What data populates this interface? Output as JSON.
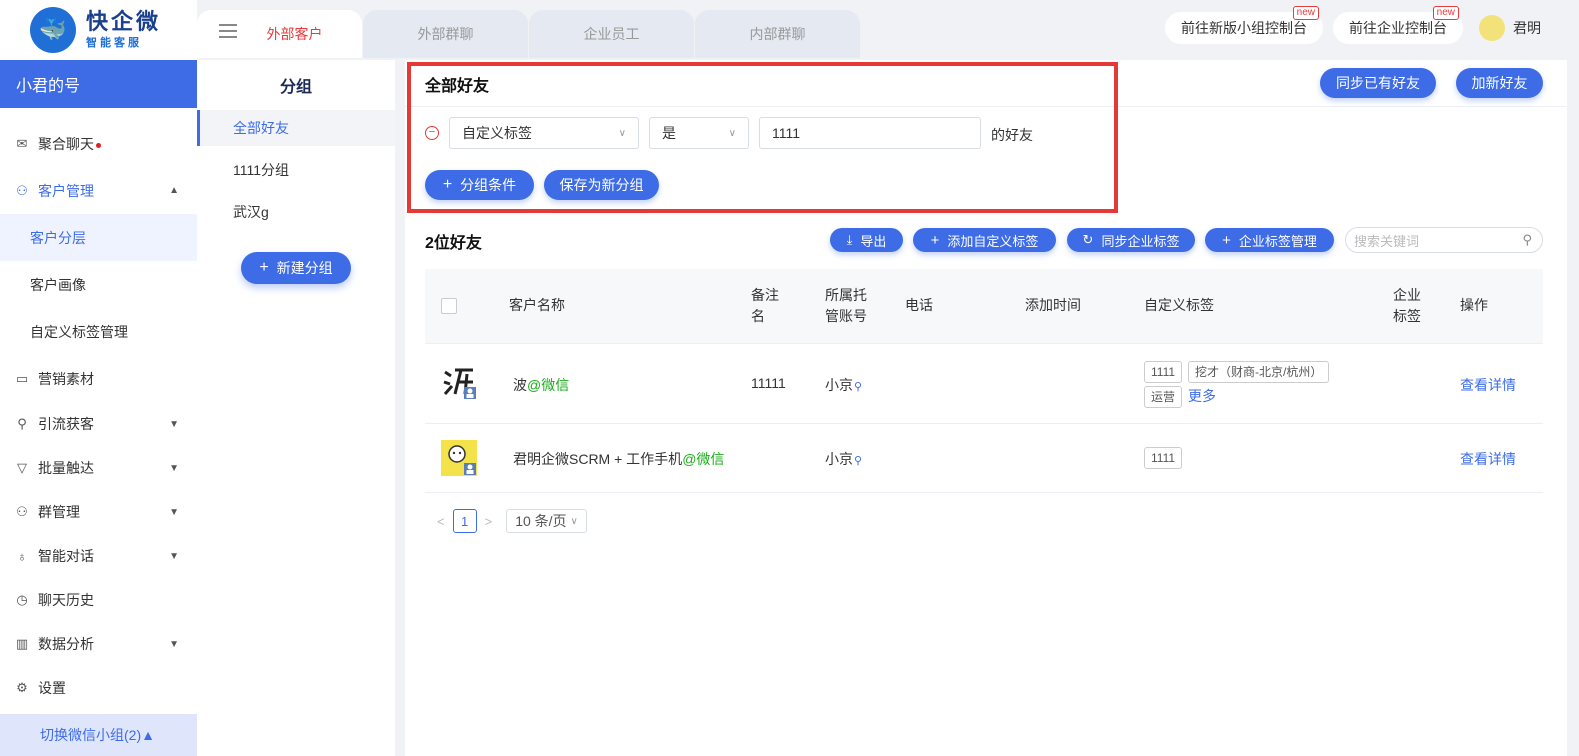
{
  "brand": {
    "title": "快企微",
    "subtitle": "智能客服"
  },
  "account_name": "小君的号",
  "sidebar": {
    "items": [
      {
        "label": "聚合聊天"
      },
      {
        "label": "客户管理"
      },
      {
        "label": "营销素材"
      },
      {
        "label": "引流获客"
      },
      {
        "label": "批量触达"
      },
      {
        "label": "群管理"
      },
      {
        "label": "智能对话"
      },
      {
        "label": "聊天历史"
      },
      {
        "label": "数据分析"
      },
      {
        "label": "设置"
      }
    ],
    "sub_items": [
      {
        "label": "客户分层"
      },
      {
        "label": "客户画像"
      },
      {
        "label": "自定义标签管理"
      }
    ],
    "switch_group": "切换微信小组(2)▲"
  },
  "tabs": [
    {
      "label": "外部客户"
    },
    {
      "label": "外部群聊"
    },
    {
      "label": "企业员工"
    },
    {
      "label": "内部群聊"
    }
  ],
  "topbar": {
    "btn_group_console": "前往新版小组控制台",
    "btn_enterprise_console": "前往企业控制台",
    "new_badge": "new",
    "user_name": "君明"
  },
  "groups": {
    "title": "分组",
    "items": [
      {
        "label": "全部好友"
      },
      {
        "label": "1111分组"
      },
      {
        "label": "武汉g"
      }
    ],
    "new_btn": "新建分组"
  },
  "main": {
    "title": "全部好友",
    "sync_friends": "同步已有好友",
    "add_friend": "加新好友",
    "filter": {
      "field": "自定义标签",
      "operator": "是",
      "value": "1111",
      "suffix": "的好友",
      "add_condition": "分组条件",
      "save_group": "保存为新分组"
    },
    "count_title": "2位好友",
    "toolbar": {
      "export": "导出",
      "add_custom_tag": "添加自定义标签",
      "sync_enterprise_tag": "同步企业标签",
      "enterprise_tag_mgmt": "企业标签管理",
      "search_placeholder": "搜索关键词"
    },
    "table": {
      "headers": {
        "name": "客户名称",
        "remark_1": "备注",
        "remark_2": "名",
        "account_1": "所属托",
        "account_2": "管账号",
        "phone": "电话",
        "added_time": "添加时间",
        "custom_tags": "自定义标签",
        "ent_tags_1": "企业",
        "ent_tags_2": "标签",
        "actions": "操作"
      },
      "rows": [
        {
          "name": "波",
          "source": "@微信",
          "remark": "11111",
          "account": "小京",
          "tags": [
            "1111",
            "挖才（财商-北京/杭州）",
            "运营"
          ],
          "more": "更多",
          "action": "查看详情"
        },
        {
          "name": "君明企微SCRM + 工作手机",
          "source": "@微信",
          "remark": "",
          "account": "小京",
          "tags": [
            "1111"
          ],
          "action": "查看详情"
        }
      ]
    },
    "pager": {
      "page": "1",
      "page_size": "10 条/页"
    }
  }
}
